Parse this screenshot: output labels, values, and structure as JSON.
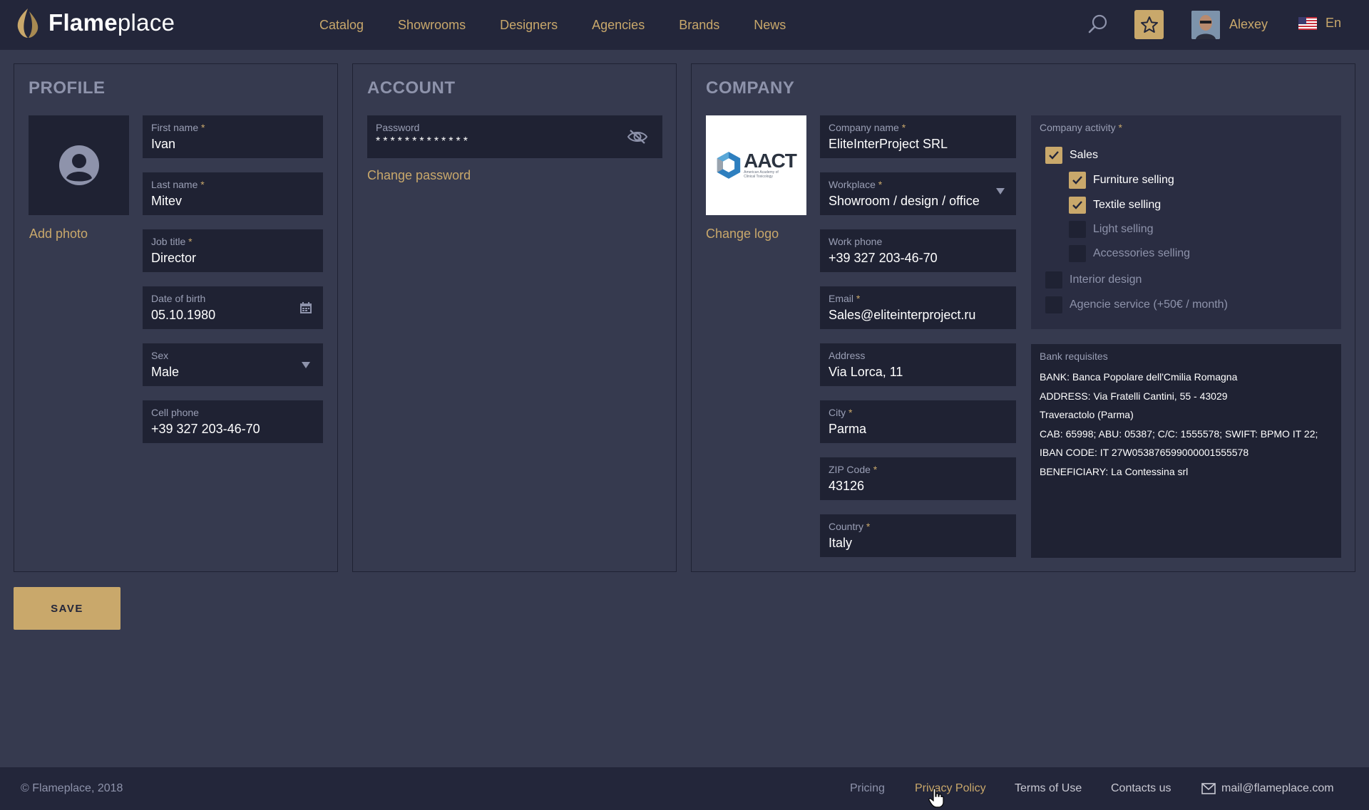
{
  "header": {
    "brand_bold": "Flame",
    "brand_light": "place",
    "nav": [
      "Catalog",
      "Showrooms",
      "Designers",
      "Agencies",
      "Brands",
      "News"
    ],
    "user_name": "Alexey",
    "language": "En",
    "icons": [
      "flame-logo-icon",
      "search-icon",
      "star-icon",
      "us-flag-icon"
    ]
  },
  "profile": {
    "title": "PROFILE",
    "add_photo": "Add photo",
    "fields": {
      "first_name": {
        "label": "First name",
        "value": "Ivan"
      },
      "last_name": {
        "label": "Last name",
        "value": "Mitev"
      },
      "job_title": {
        "label": "Job title",
        "value": "Director"
      },
      "dob": {
        "label": "Date of birth",
        "value": "05.10.1980"
      },
      "sex": {
        "label": "Sex",
        "value": "Male"
      },
      "cell_phone": {
        "label": "Cell phone",
        "value": "+39 327 203-46-70"
      }
    }
  },
  "account": {
    "title": "ACCOUNT",
    "password": {
      "label": "Password",
      "value": "*************"
    },
    "change_password": "Change password"
  },
  "company": {
    "title": "COMPANY",
    "logo_text": "AACT",
    "logo_subtext": "American Academy of Clinical Toxicology",
    "change_logo": "Change logo",
    "fields": {
      "company_name": {
        "label": "Company name",
        "value": "EliteInterProject SRL"
      },
      "workplace": {
        "label": "Workplace",
        "value": "Showroom / design / office"
      },
      "work_phone": {
        "label": "Work phone",
        "value": "+39 327 203-46-70"
      },
      "email": {
        "label": "Email",
        "value": "Sales@eliteinterproject.ru"
      },
      "address": {
        "label": "Address",
        "value": "Via Lorca, 11"
      },
      "city": {
        "label": "City",
        "value": "Parma"
      },
      "zip": {
        "label": "ZIP Code",
        "value": "43126"
      },
      "country": {
        "label": "Country",
        "value": "Italy"
      }
    },
    "activity": {
      "label": "Company activity",
      "items": [
        {
          "label": "Sales",
          "checked": true
        },
        {
          "label": "Furniture selling",
          "checked": true
        },
        {
          "label": "Textile selling",
          "checked": true
        },
        {
          "label": "Light selling",
          "checked": false
        },
        {
          "label": "Accessories selling",
          "checked": false
        },
        {
          "label": "Interior design",
          "checked": false
        },
        {
          "label": "Agencie service (+50€ / month)",
          "checked": false
        }
      ]
    },
    "bank": {
      "label": "Bank requisites",
      "lines": [
        "BANK: Banca Popolare dell'Cmilia Romagna",
        "ADDRESS: Via Fratelli Cantini, 55 - 43029",
        "Traveractolo (Parma)",
        "CAB: 65998; ABU: 05387; C/C: 1555578; SWIFT: BPMO IT 22;",
        "IBAN CODE: IT 27W053876599000001555578",
        "BENEFICIARY: La Contessina srl"
      ]
    }
  },
  "save_label": "SAVE",
  "footer": {
    "copyright": "© Flameplace, 2018",
    "links": [
      "Pricing",
      "Privacy Policy",
      "Terms of Use",
      "Contacts us"
    ],
    "email": "mail@flameplace.com"
  },
  "colors": {
    "accent": "#c9a86b",
    "background": "#363a4f",
    "header": "#23263a",
    "field": "#1f2233"
  }
}
